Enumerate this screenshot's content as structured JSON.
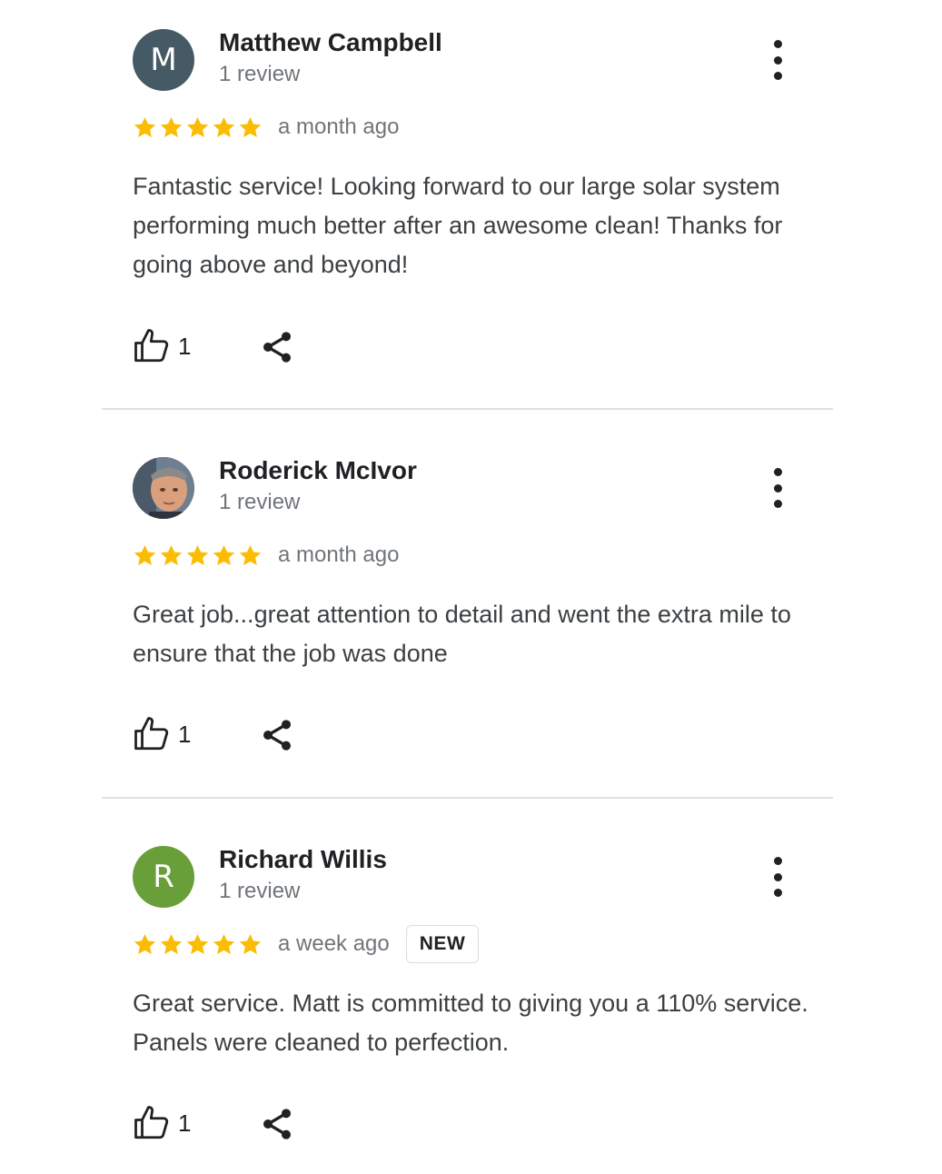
{
  "reviews": [
    {
      "avatar_letter": "M",
      "avatar_color": "#455a64",
      "name": "Matthew Campbell",
      "review_count": "1 review",
      "rating": 5,
      "time": "a month ago",
      "text": "Fantastic service! Looking forward to our large solar system performing much better after an awesome clean! Thanks for going above and beyond!",
      "likes": "1"
    },
    {
      "avatar_letter": "",
      "avatar_color": "#8d6e63",
      "name": "Roderick McIvor",
      "review_count": "1 review",
      "rating": 5,
      "time": "a month ago",
      "text": "Great job...great attention to detail and went the extra mile to ensure that the job was done",
      "likes": "1"
    },
    {
      "avatar_letter": "R",
      "avatar_color": "#689f38",
      "name": "Richard Willis",
      "review_count": "1 review",
      "rating": 5,
      "time": "a week ago",
      "badge": "NEW",
      "text": "Great service. Matt is committed to giving you a 110% service. Panels were cleaned to perfection.",
      "likes": "1"
    }
  ],
  "colors": {
    "star": "#fbbc04",
    "divider": "#e0e0e0",
    "secondary_text": "#70757a"
  },
  "icons": {
    "like": "thumb-up-outline-icon",
    "share": "share-icon",
    "menu": "more-vert-icon",
    "star": "star-icon"
  }
}
